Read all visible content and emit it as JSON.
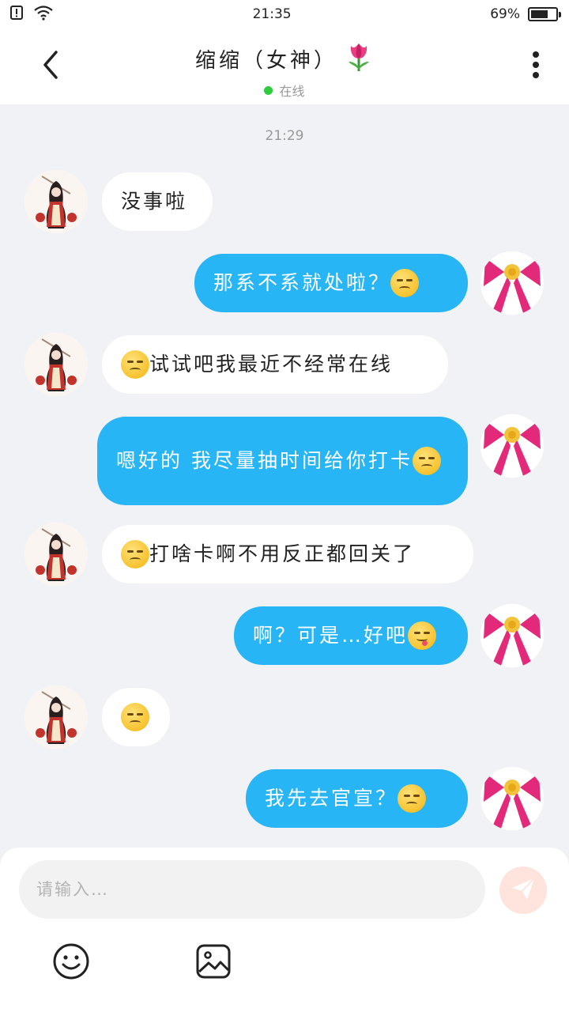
{
  "status_bar": {
    "time": "21:35",
    "battery_text": "69%",
    "battery_level": 0.69
  },
  "header": {
    "title": "缩缩（女神）",
    "presence": "在线",
    "icons": {
      "back": "chevron-left-icon",
      "title_emoji": "tulip-icon",
      "more": "more-vertical-icon"
    }
  },
  "chat": {
    "timestamp": "21:29",
    "messages": [
      {
        "side": "in",
        "text": "没事啦",
        "emoji_before": "",
        "emoji_after": ""
      },
      {
        "side": "out",
        "text": "那系不系就处啦？",
        "emoji_before": "",
        "emoji_after": "frowning-face"
      },
      {
        "side": "in",
        "text": "试试吧我最近不经常在线",
        "emoji_before": "pensive-face",
        "emoji_after": ""
      },
      {
        "side": "out",
        "text": "嗯好的 我尽量抽时间给你打卡",
        "emoji_before": "",
        "emoji_after": "pensive-face"
      },
      {
        "side": "in",
        "text": "打啥卡啊不用反正都回关了",
        "emoji_before": "pensive-face",
        "emoji_after": ""
      },
      {
        "side": "out",
        "text": "啊？可是…好吧",
        "emoji_before": "",
        "emoji_after": "yum-face"
      },
      {
        "side": "in",
        "text": "",
        "emoji_before": "pensive-face",
        "emoji_after": ""
      },
      {
        "side": "out",
        "text": "我先去官宣？",
        "emoji_before": "",
        "emoji_after": "pensive-face"
      }
    ]
  },
  "composer": {
    "placeholder": "请输入…",
    "value": "",
    "icons": {
      "send": "send-icon",
      "emoji": "smiley-icon",
      "image": "image-icon"
    }
  },
  "colors": {
    "outgoing_bubble": "#27b5f6",
    "incoming_bubble": "#ffffff",
    "background": "#f0f2f5",
    "online_dot": "#2ecc40",
    "send_button": "#ffe3dd"
  }
}
